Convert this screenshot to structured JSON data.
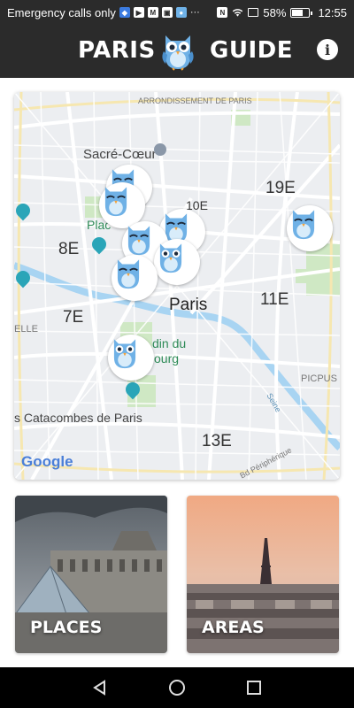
{
  "status_bar": {
    "left_text": "Emergency calls only",
    "battery": "58%",
    "battery_level": 0.58,
    "time": "12:55"
  },
  "header": {
    "title_left": "PARIS",
    "title_right": "GUIDE",
    "info_icon": "info-icon",
    "info_glyph": "i"
  },
  "map": {
    "labels": {
      "arrondissement": "ARRONDISSEMENT DE PARIS",
      "sacre_coeur": "Sacré-Cœur",
      "e19": "19E",
      "e10": "10E",
      "e8": "8E",
      "place": "Plac",
      "paris": "Paris",
      "e11": "11E",
      "e7": "7E",
      "elle": "ELLE",
      "luxembourg_1": "din du",
      "luxembourg_2": "ourg",
      "picpus": "PICPUS",
      "seine": "Seine",
      "catacombes": "s Catacombes de Paris",
      "e13": "13E",
      "bd_peripherique": "Bd Périphérique"
    },
    "google_logo": "Google",
    "marker_icon": "owl-icon"
  },
  "cards": {
    "places": "PLACES",
    "areas": "AREAS"
  },
  "nav": {
    "back_icon": "back-triangle-icon",
    "home_icon": "home-circle-icon",
    "recents_icon": "recents-square-icon"
  }
}
